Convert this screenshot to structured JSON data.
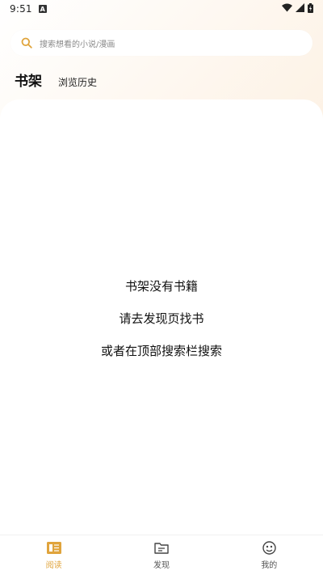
{
  "status_bar": {
    "time": "9:51",
    "notification_badge": "A",
    "icons": [
      "wifi-icon",
      "signal-icon",
      "battery-icon"
    ]
  },
  "search": {
    "placeholder": "搜索想看的小说/漫画",
    "icon": "search-icon"
  },
  "tabs": [
    {
      "label": "书架",
      "active": true
    },
    {
      "label": "浏览历史",
      "active": false
    }
  ],
  "empty_state": {
    "line1": "书架没有书籍",
    "line2": "请去发现页找书",
    "line3": "或者在顶部搜索栏搜索"
  },
  "bottom_nav": [
    {
      "label": "阅读",
      "icon": "book-icon",
      "active": true
    },
    {
      "label": "发现",
      "icon": "discover-icon",
      "active": false
    },
    {
      "label": "我的",
      "icon": "profile-icon",
      "active": false
    }
  ],
  "colors": {
    "accent": "#e0a43c",
    "background_gradient_end": "#fbe8dc"
  }
}
